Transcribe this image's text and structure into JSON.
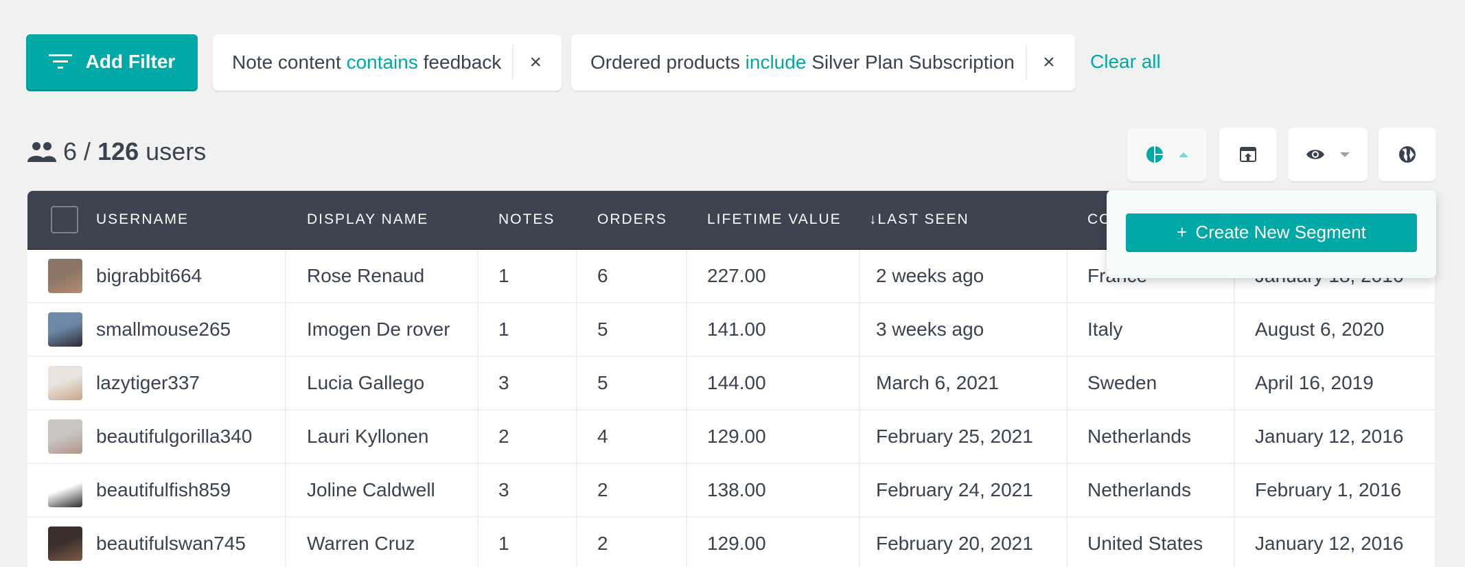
{
  "filters": {
    "add_filter_label": "Add Filter",
    "add_filter_icon": "filter-icon",
    "chips": [
      {
        "field": "Note content",
        "operator": "contains",
        "value": "feedback",
        "remove_icon": "×"
      },
      {
        "field": "Ordered products",
        "operator": "include",
        "value": "Silver Plan Subscription",
        "remove_icon": "×"
      }
    ],
    "clear_all_label": "Clear all"
  },
  "summary": {
    "icon": "users-icon",
    "shown": "6",
    "separator": "/",
    "total": "126",
    "unit": "users"
  },
  "toolbar": {
    "buttons": [
      {
        "name": "segments",
        "icon": "pie-chart-icon",
        "caret": "up",
        "active": true
      },
      {
        "name": "export",
        "icon": "export-icon"
      },
      {
        "name": "columns-visibility",
        "icon": "eye-icon",
        "caret": "down"
      },
      {
        "name": "map-view",
        "icon": "globe-icon"
      }
    ]
  },
  "segment_popover": {
    "create_label": "Create New Segment",
    "create_icon": "+"
  },
  "colors": {
    "accent": "#00a9a5",
    "header_bg": "#3d444f",
    "page_bg": "#f1f1f1",
    "text": "#3a4250"
  },
  "table": {
    "columns": [
      {
        "key": "username",
        "label": "USERNAME"
      },
      {
        "key": "display_name",
        "label": "DISPLAY NAME"
      },
      {
        "key": "notes",
        "label": "NOTES"
      },
      {
        "key": "orders",
        "label": "ORDERS"
      },
      {
        "key": "lifetime_value",
        "label": "LIFETIME VALUE"
      },
      {
        "key": "last_seen",
        "label": "LAST SEEN",
        "sort_icon": "↓"
      },
      {
        "key": "country",
        "label": "COUNTRY"
      },
      {
        "key": "first_seen",
        "label": ""
      }
    ],
    "rows": [
      {
        "username": "bigrabbit664",
        "display_name": "Rose Renaud",
        "notes": "1",
        "orders": "6",
        "lifetime_value": "227.00",
        "last_seen": "2 weeks ago",
        "country": "France",
        "first_seen": "January 18, 2016"
      },
      {
        "username": "smallmouse265",
        "display_name": "Imogen De rover",
        "notes": "1",
        "orders": "5",
        "lifetime_value": "141.00",
        "last_seen": "3 weeks ago",
        "country": "Italy",
        "first_seen": "August 6, 2020"
      },
      {
        "username": "lazytiger337",
        "display_name": "Lucia Gallego",
        "notes": "3",
        "orders": "5",
        "lifetime_value": "144.00",
        "last_seen": "March 6, 2021",
        "country": "Sweden",
        "first_seen": "April 16, 2019"
      },
      {
        "username": "beautifulgorilla340",
        "display_name": "Lauri Kyllonen",
        "notes": "2",
        "orders": "4",
        "lifetime_value": "129.00",
        "last_seen": "February 25, 2021",
        "country": "Netherlands",
        "first_seen": "January 12, 2016"
      },
      {
        "username": "beautifulfish859",
        "display_name": "Joline Caldwell",
        "notes": "3",
        "orders": "2",
        "lifetime_value": "138.00",
        "last_seen": "February 24, 2021",
        "country": "Netherlands",
        "first_seen": "February 1, 2016"
      },
      {
        "username": "beautifulswan745",
        "display_name": "Warren Cruz",
        "notes": "1",
        "orders": "2",
        "lifetime_value": "129.00",
        "last_seen": "February 20, 2021",
        "country": "United States",
        "first_seen": "January 12, 2016"
      }
    ]
  }
}
